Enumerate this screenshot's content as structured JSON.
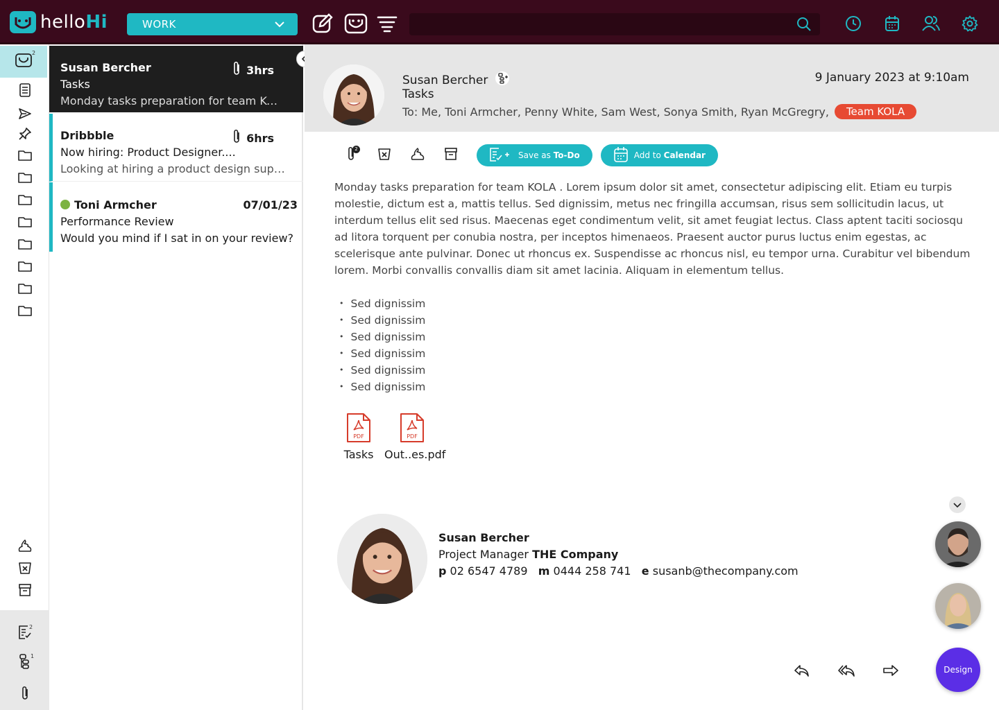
{
  "app": {
    "logo_prefix": "hello",
    "logo_suffix": "Hi",
    "workspace": "WORK",
    "brand_color": "#1fb8c3",
    "topbar_color": "#3a0a1c"
  },
  "search": {
    "placeholder": ""
  },
  "rail": {
    "inbox_badge": "2",
    "todo_badge": "2",
    "tasks_badge": "1"
  },
  "messages": [
    {
      "from": "Susan Bercher",
      "time": "3hrs",
      "subject": "Tasks",
      "preview": "Monday tasks preparation for team KOLA..."
    },
    {
      "from": "Dribbble",
      "time": "6hrs",
      "subject": "Now hiring: Product Designer....",
      "preview": "Looking at hiring a product design super st.."
    },
    {
      "from": "Toni Armcher",
      "time": "07/01/23",
      "subject": "Performance Review",
      "preview": "Would you mind if I sat in on your review?"
    }
  ],
  "email": {
    "from": "Susan Bercher",
    "subject": "Tasks",
    "to": "To: Me, Toni Armcher, Penny White, Sam West, Sonya Smith, Ryan McGregry,",
    "tag": "Team KOLA",
    "date": "9 January 2023 at 9:10am",
    "attach_count": "2",
    "save_todo_prefix": "Save as",
    "save_todo_bold": "To-Do",
    "add_cal_prefix": "Add to",
    "add_cal_bold": "Calendar",
    "body": "Monday tasks preparation for team KOLA . Lorem ipsum dolor sit amet, consectetur adipiscing elit. Etiam eu turpis molestie, dictum est a, mattis tellus. Sed dignissim, metus nec fringilla accumsan, risus sem sollicitudin lacus, ut interdum tellus elit sed risus. Maecenas eget condimentum velit, sit amet feugiat lectus. Class aptent taciti sociosqu ad litora torquent per conubia nostra, per inceptos himenaeos. Praesent auctor purus luctus enim egestas, ac scelerisque ante pulvinar. Donec ut rhoncus ex. Suspendisse ac rhoncus nisl, eu tempor urna. Curabitur vel bibendum lorem. Morbi convallis convallis diam sit amet lacinia. Aliquam in elementum tellus.",
    "bullets": [
      "Sed dignissim",
      "Sed dignissim",
      "Sed dignissim",
      "Sed dignissim",
      "Sed dignissim",
      "Sed dignissim"
    ],
    "attachments": [
      {
        "label": "Tasks",
        "type": "PDF"
      },
      {
        "label": "Out..es.pdf",
        "type": "PDF"
      }
    ]
  },
  "signature": {
    "name": "Susan Bercher",
    "role": "Project Manager",
    "company": "THE Company",
    "p_label": "p",
    "phone": "02 6547 4789",
    "m_label": "m",
    "mobile": "0444 258 741",
    "e_label": "e",
    "email": "susanb@thecompany.com"
  },
  "floating": {
    "design_label": "Design"
  }
}
